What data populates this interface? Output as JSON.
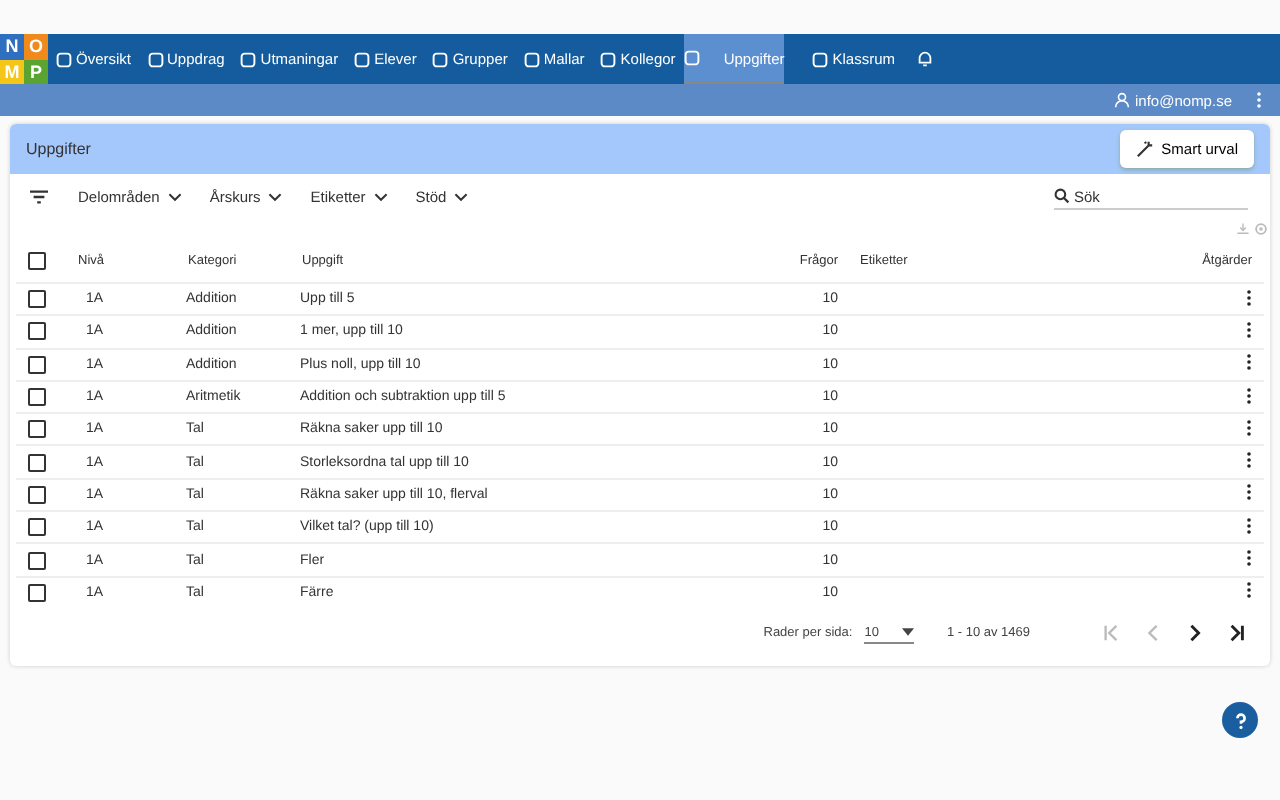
{
  "logo": [
    "N",
    "O",
    "M",
    "P"
  ],
  "nav": [
    {
      "label": "Översikt",
      "selected": false
    },
    {
      "label": "Uppdrag",
      "selected": false
    },
    {
      "label": "Utmaningar",
      "selected": false
    },
    {
      "label": "Elever",
      "selected": false
    },
    {
      "label": "Grupper",
      "selected": false
    },
    {
      "label": "Mallar",
      "selected": false
    },
    {
      "label": "Kollegor",
      "selected": false
    },
    {
      "label": "Uppgifter",
      "selected": true
    },
    {
      "label": "Klassrum",
      "selected": false
    }
  ],
  "user": "info@nomp.se",
  "panel": {
    "title": "Uppgifter",
    "smart_button": "Smart urval"
  },
  "filters": [
    "Delområden",
    "Årskurs",
    "Etiketter",
    "Stöd"
  ],
  "search": {
    "placeholder": "Sök"
  },
  "table": {
    "columns": [
      "Nivå",
      "Kategori",
      "Uppgift",
      "Frågor",
      "Etiketter",
      "Åtgärder"
    ],
    "header_checked": false,
    "rows": [
      {
        "level": "1A",
        "category": "Addition",
        "task": "Upp till 5",
        "questions": "10",
        "checked": false
      },
      {
        "level": "1A",
        "category": "Addition",
        "task": "1 mer, upp till 10",
        "questions": "10",
        "checked": false
      },
      {
        "level": "1A",
        "category": "Addition",
        "task": "Plus noll, upp till 10",
        "questions": "10",
        "checked": false
      },
      {
        "level": "1A",
        "category": "Aritmetik",
        "task": "Addition och subtraktion upp till 5",
        "questions": "10",
        "checked": false
      },
      {
        "level": "1A",
        "category": "Tal",
        "task": "Räkna saker upp till 10",
        "questions": "10",
        "checked": false
      },
      {
        "level": "1A",
        "category": "Tal",
        "task": "Storleksordna tal upp till 10",
        "questions": "10",
        "checked": false
      },
      {
        "level": "1A",
        "category": "Tal",
        "task": "Räkna saker upp till 10, flerval",
        "questions": "10",
        "checked": false
      },
      {
        "level": "1A",
        "category": "Tal",
        "task": "Vilket tal? (upp till 10)",
        "questions": "10",
        "checked": false
      },
      {
        "level": "1A",
        "category": "Tal",
        "task": "Fler",
        "questions": "10",
        "checked": false
      },
      {
        "level": "1A",
        "category": "Tal",
        "task": "Färre",
        "questions": "10",
        "checked": false
      }
    ]
  },
  "pagination": {
    "rows_label": "Rader per sida:",
    "rows_value": "10",
    "range": "1 - 10 av 1469"
  }
}
